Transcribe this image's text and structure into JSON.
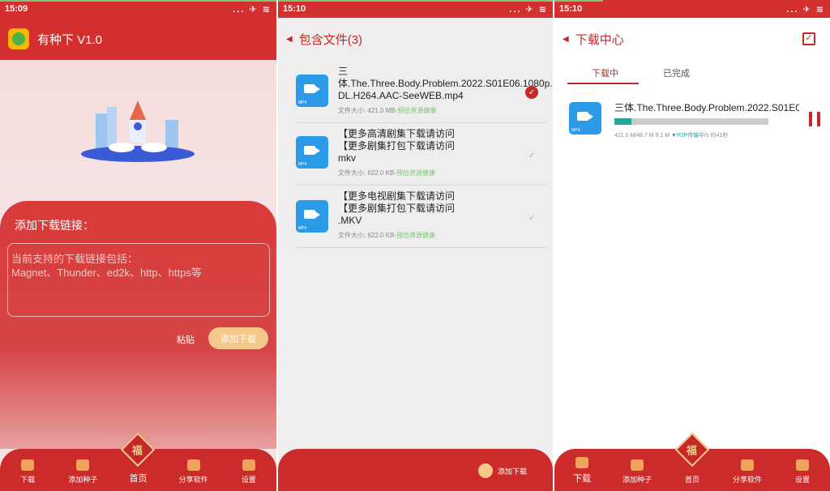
{
  "panel1": {
    "time": "15:09",
    "status_icons": "... ✈ ≋",
    "app_title": "有种下 V1.0",
    "card_label": "添加下载链接：",
    "placeholder_line1": "当前支持的下载链接包括：",
    "placeholder_line2": "Magnet、Thunder、ed2k、http、https等",
    "paste_label": "粘贴",
    "add_button": "添加下载",
    "tabs": [
      "下载",
      "添加种子",
      "首页",
      "分享软件",
      "设置"
    ],
    "fu_char": "福"
  },
  "panel2": {
    "time": "15:10",
    "status_icons": "... ✈ ≋",
    "title": "包含文件(3)",
    "files": [
      {
        "name": "三体.The.Three.Body.Problem.2022.S01E06.1080p.WEB-DL.H264.AAC-SeeWEB.mp4",
        "size_prefix": "文件大小: 421.0 MB-",
        "health": "预估资源健康",
        "checked": true
      },
      {
        "name": "【更多高清剧集下载请访问                 【更多剧集打包下载请访问                                      mkv",
        "size_prefix": "文件大小: 622.0 KB-",
        "health": "预估资源健康",
        "checked": false
      },
      {
        "name": "【更多电视剧集下载请访问                    【更多剧集打包下载请访问                                     .MKV",
        "size_prefix": "文件大小: 622.0 KB-",
        "health": "预估资源健康",
        "checked": false
      }
    ],
    "file_tag": "MP4",
    "download_button": "添加下载"
  },
  "panel3": {
    "time": "15:10",
    "status_icons": "... ✈ ≋",
    "title": "下载中心",
    "tab_downloading": "下载中",
    "tab_done": "已完成",
    "task_name": "三体.The.Three.Body.Problem.2022.S01E0...",
    "task_progress": 0.11,
    "task_info_prefix": "421.0 M/48.7 M 9.1 M ",
    "task_p2p": "▼P2P传输中",
    "task_info_suffix": "/s 约41秒",
    "tabs": [
      "下载",
      "添加种子",
      "首页",
      "分享软件",
      "设置"
    ],
    "fu_char": "福"
  }
}
